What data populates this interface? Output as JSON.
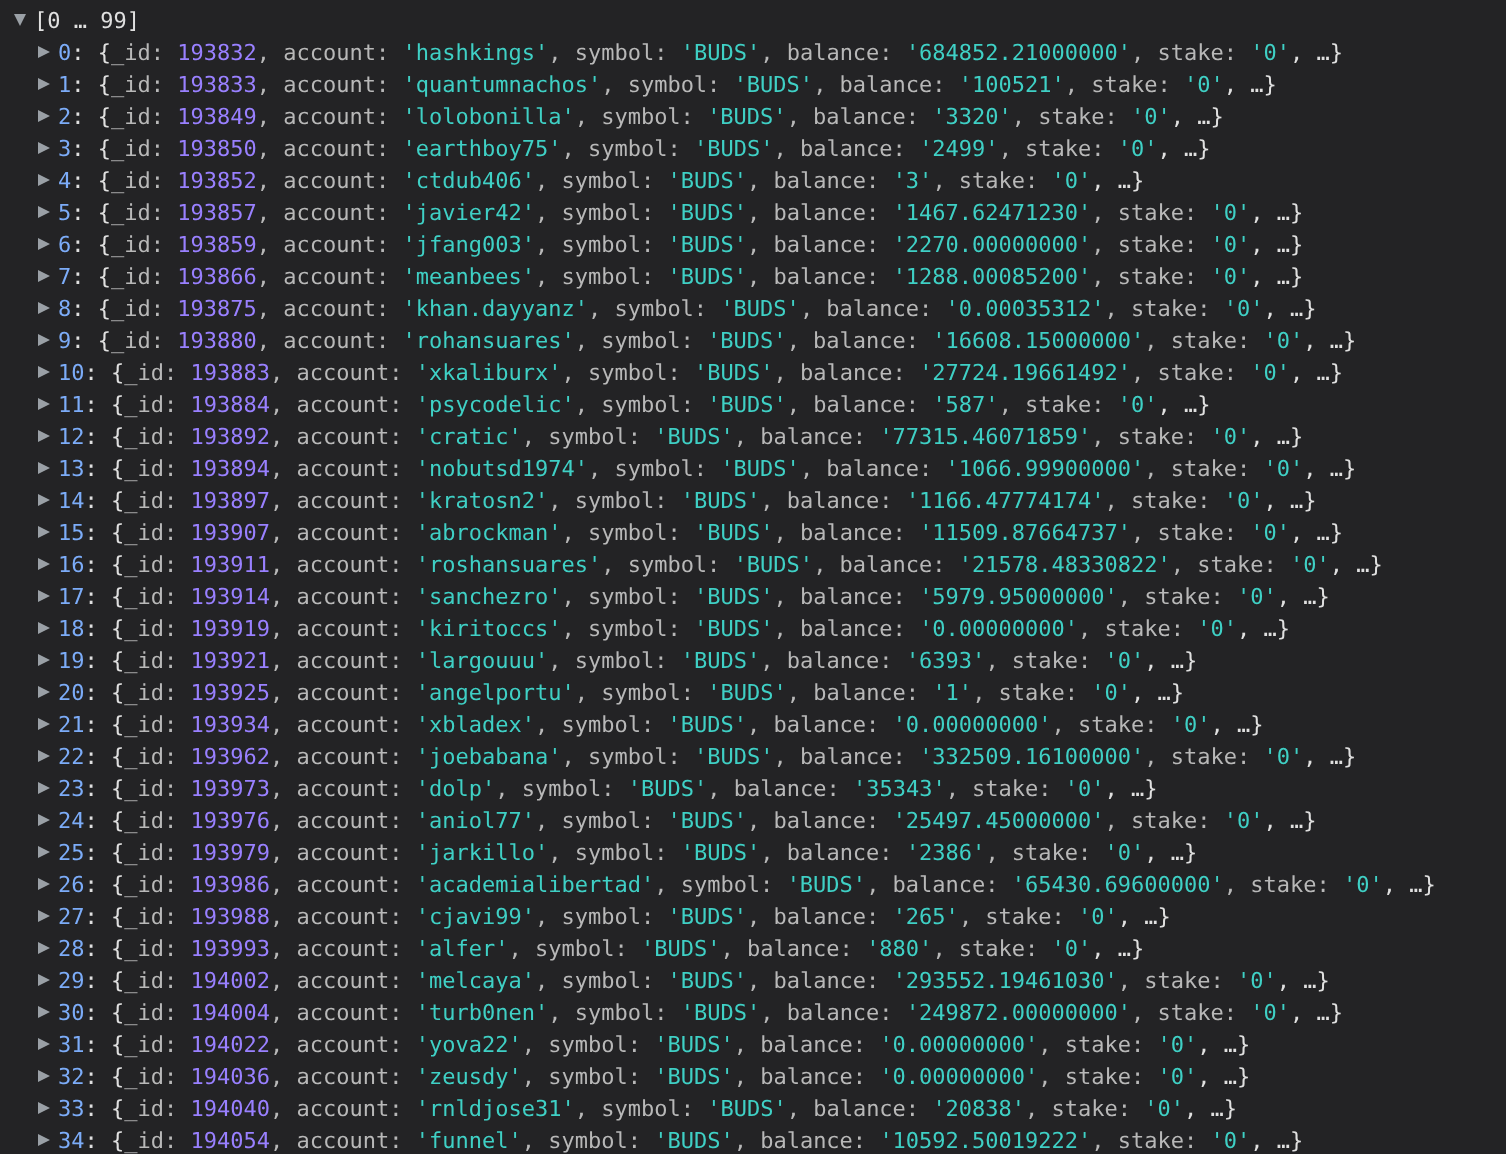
{
  "array": {
    "label": "[0 … 99]",
    "expanded": true
  },
  "rows": [
    {
      "expanded": false,
      "index": "0",
      "open": ": {",
      "fields": [
        {
          "key": "_id: ",
          "value": "193832",
          "kind": "number"
        },
        {
          "key": ", account: ",
          "value": "'hashkings'",
          "kind": "string"
        },
        {
          "key": ", symbol: ",
          "value": "'BUDS'",
          "kind": "string"
        },
        {
          "key": ", balance: ",
          "value": "'684852.21000000'",
          "kind": "string"
        },
        {
          "key": ", stake: ",
          "value": "'0'",
          "kind": "string"
        }
      ],
      "more": ", …}"
    },
    {
      "expanded": false,
      "index": "1",
      "open": ": {",
      "fields": [
        {
          "key": "_id: ",
          "value": "193833",
          "kind": "number"
        },
        {
          "key": ", account: ",
          "value": "'quantumnachos'",
          "kind": "string"
        },
        {
          "key": ", symbol: ",
          "value": "'BUDS'",
          "kind": "string"
        },
        {
          "key": ", balance: ",
          "value": "'100521'",
          "kind": "string"
        },
        {
          "key": ", stake: ",
          "value": "'0'",
          "kind": "string"
        }
      ],
      "more": ", …}"
    },
    {
      "expanded": false,
      "index": "2",
      "open": ": {",
      "fields": [
        {
          "key": "_id: ",
          "value": "193849",
          "kind": "number"
        },
        {
          "key": ", account: ",
          "value": "'lolobonilla'",
          "kind": "string"
        },
        {
          "key": ", symbol: ",
          "value": "'BUDS'",
          "kind": "string"
        },
        {
          "key": ", balance: ",
          "value": "'3320'",
          "kind": "string"
        },
        {
          "key": ", stake: ",
          "value": "'0'",
          "kind": "string"
        }
      ],
      "more": ", …}"
    },
    {
      "expanded": false,
      "index": "3",
      "open": ": {",
      "fields": [
        {
          "key": "_id: ",
          "value": "193850",
          "kind": "number"
        },
        {
          "key": ", account: ",
          "value": "'earthboy75'",
          "kind": "string"
        },
        {
          "key": ", symbol: ",
          "value": "'BUDS'",
          "kind": "string"
        },
        {
          "key": ", balance: ",
          "value": "'2499'",
          "kind": "string"
        },
        {
          "key": ", stake: ",
          "value": "'0'",
          "kind": "string"
        }
      ],
      "more": ", …}"
    },
    {
      "expanded": false,
      "index": "4",
      "open": ": {",
      "fields": [
        {
          "key": "_id: ",
          "value": "193852",
          "kind": "number"
        },
        {
          "key": ", account: ",
          "value": "'ctdub406'",
          "kind": "string"
        },
        {
          "key": ", symbol: ",
          "value": "'BUDS'",
          "kind": "string"
        },
        {
          "key": ", balance: ",
          "value": "'3'",
          "kind": "string"
        },
        {
          "key": ", stake: ",
          "value": "'0'",
          "kind": "string"
        }
      ],
      "more": ", …}"
    },
    {
      "expanded": false,
      "index": "5",
      "open": ": {",
      "fields": [
        {
          "key": "_id: ",
          "value": "193857",
          "kind": "number"
        },
        {
          "key": ", account: ",
          "value": "'javier42'",
          "kind": "string"
        },
        {
          "key": ", symbol: ",
          "value": "'BUDS'",
          "kind": "string"
        },
        {
          "key": ", balance: ",
          "value": "'1467.62471230'",
          "kind": "string"
        },
        {
          "key": ", stake: ",
          "value": "'0'",
          "kind": "string"
        }
      ],
      "more": ", …}"
    },
    {
      "expanded": false,
      "index": "6",
      "open": ": {",
      "fields": [
        {
          "key": "_id: ",
          "value": "193859",
          "kind": "number"
        },
        {
          "key": ", account: ",
          "value": "'jfang003'",
          "kind": "string"
        },
        {
          "key": ", symbol: ",
          "value": "'BUDS'",
          "kind": "string"
        },
        {
          "key": ", balance: ",
          "value": "'2270.00000000'",
          "kind": "string"
        },
        {
          "key": ", stake: ",
          "value": "'0'",
          "kind": "string"
        }
      ],
      "more": ", …}"
    },
    {
      "expanded": false,
      "index": "7",
      "open": ": {",
      "fields": [
        {
          "key": "_id: ",
          "value": "193866",
          "kind": "number"
        },
        {
          "key": ", account: ",
          "value": "'meanbees'",
          "kind": "string"
        },
        {
          "key": ", symbol: ",
          "value": "'BUDS'",
          "kind": "string"
        },
        {
          "key": ", balance: ",
          "value": "'1288.00085200'",
          "kind": "string"
        },
        {
          "key": ", stake: ",
          "value": "'0'",
          "kind": "string"
        }
      ],
      "more": ", …}"
    },
    {
      "expanded": false,
      "index": "8",
      "open": ": {",
      "fields": [
        {
          "key": "_id: ",
          "value": "193875",
          "kind": "number"
        },
        {
          "key": ", account: ",
          "value": "'khan.dayyanz'",
          "kind": "string"
        },
        {
          "key": ", symbol: ",
          "value": "'BUDS'",
          "kind": "string"
        },
        {
          "key": ", balance: ",
          "value": "'0.00035312'",
          "kind": "string"
        },
        {
          "key": ", stake: ",
          "value": "'0'",
          "kind": "string"
        }
      ],
      "more": ", …}"
    },
    {
      "expanded": false,
      "index": "9",
      "open": ": {",
      "fields": [
        {
          "key": "_id: ",
          "value": "193880",
          "kind": "number"
        },
        {
          "key": ", account: ",
          "value": "'rohansuares'",
          "kind": "string"
        },
        {
          "key": ", symbol: ",
          "value": "'BUDS'",
          "kind": "string"
        },
        {
          "key": ", balance: ",
          "value": "'16608.15000000'",
          "kind": "string"
        },
        {
          "key": ", stake: ",
          "value": "'0'",
          "kind": "string"
        }
      ],
      "more": ", …}"
    },
    {
      "expanded": false,
      "index": "10",
      "open": ": {",
      "fields": [
        {
          "key": "_id: ",
          "value": "193883",
          "kind": "number"
        },
        {
          "key": ", account: ",
          "value": "'xkaliburx'",
          "kind": "string"
        },
        {
          "key": ", symbol: ",
          "value": "'BUDS'",
          "kind": "string"
        },
        {
          "key": ", balance: ",
          "value": "'27724.19661492'",
          "kind": "string"
        },
        {
          "key": ", stake: ",
          "value": "'0'",
          "kind": "string"
        }
      ],
      "more": ", …}"
    },
    {
      "expanded": false,
      "index": "11",
      "open": ": {",
      "fields": [
        {
          "key": "_id: ",
          "value": "193884",
          "kind": "number"
        },
        {
          "key": ", account: ",
          "value": "'psycodelic'",
          "kind": "string"
        },
        {
          "key": ", symbol: ",
          "value": "'BUDS'",
          "kind": "string"
        },
        {
          "key": ", balance: ",
          "value": "'587'",
          "kind": "string"
        },
        {
          "key": ", stake: ",
          "value": "'0'",
          "kind": "string"
        }
      ],
      "more": ", …}"
    },
    {
      "expanded": false,
      "index": "12",
      "open": ": {",
      "fields": [
        {
          "key": "_id: ",
          "value": "193892",
          "kind": "number"
        },
        {
          "key": ", account: ",
          "value": "'cratic'",
          "kind": "string"
        },
        {
          "key": ", symbol: ",
          "value": "'BUDS'",
          "kind": "string"
        },
        {
          "key": ", balance: ",
          "value": "'77315.46071859'",
          "kind": "string"
        },
        {
          "key": ", stake: ",
          "value": "'0'",
          "kind": "string"
        }
      ],
      "more": ", …}"
    },
    {
      "expanded": false,
      "index": "13",
      "open": ": {",
      "fields": [
        {
          "key": "_id: ",
          "value": "193894",
          "kind": "number"
        },
        {
          "key": ", account: ",
          "value": "'nobutsd1974'",
          "kind": "string"
        },
        {
          "key": ", symbol: ",
          "value": "'BUDS'",
          "kind": "string"
        },
        {
          "key": ", balance: ",
          "value": "'1066.99900000'",
          "kind": "string"
        },
        {
          "key": ", stake: ",
          "value": "'0'",
          "kind": "string"
        }
      ],
      "more": ", …}"
    },
    {
      "expanded": false,
      "index": "14",
      "open": ": {",
      "fields": [
        {
          "key": "_id: ",
          "value": "193897",
          "kind": "number"
        },
        {
          "key": ", account: ",
          "value": "'kratosn2'",
          "kind": "string"
        },
        {
          "key": ", symbol: ",
          "value": "'BUDS'",
          "kind": "string"
        },
        {
          "key": ", balance: ",
          "value": "'1166.47774174'",
          "kind": "string"
        },
        {
          "key": ", stake: ",
          "value": "'0'",
          "kind": "string"
        }
      ],
      "more": ", …}"
    },
    {
      "expanded": false,
      "index": "15",
      "open": ": {",
      "fields": [
        {
          "key": "_id: ",
          "value": "193907",
          "kind": "number"
        },
        {
          "key": ", account: ",
          "value": "'abrockman'",
          "kind": "string"
        },
        {
          "key": ", symbol: ",
          "value": "'BUDS'",
          "kind": "string"
        },
        {
          "key": ", balance: ",
          "value": "'11509.87664737'",
          "kind": "string"
        },
        {
          "key": ", stake: ",
          "value": "'0'",
          "kind": "string"
        }
      ],
      "more": ", …}"
    },
    {
      "expanded": false,
      "index": "16",
      "open": ": {",
      "fields": [
        {
          "key": "_id: ",
          "value": "193911",
          "kind": "number"
        },
        {
          "key": ", account: ",
          "value": "'roshansuares'",
          "kind": "string"
        },
        {
          "key": ", symbol: ",
          "value": "'BUDS'",
          "kind": "string"
        },
        {
          "key": ", balance: ",
          "value": "'21578.48330822'",
          "kind": "string"
        },
        {
          "key": ", stake: ",
          "value": "'0'",
          "kind": "string"
        }
      ],
      "more": ", …}"
    },
    {
      "expanded": false,
      "index": "17",
      "open": ": {",
      "fields": [
        {
          "key": "_id: ",
          "value": "193914",
          "kind": "number"
        },
        {
          "key": ", account: ",
          "value": "'sanchezro'",
          "kind": "string"
        },
        {
          "key": ", symbol: ",
          "value": "'BUDS'",
          "kind": "string"
        },
        {
          "key": ", balance: ",
          "value": "'5979.95000000'",
          "kind": "string"
        },
        {
          "key": ", stake: ",
          "value": "'0'",
          "kind": "string"
        }
      ],
      "more": ", …}"
    },
    {
      "expanded": false,
      "index": "18",
      "open": ": {",
      "fields": [
        {
          "key": "_id: ",
          "value": "193919",
          "kind": "number"
        },
        {
          "key": ", account: ",
          "value": "'kiritoccs'",
          "kind": "string"
        },
        {
          "key": ", symbol: ",
          "value": "'BUDS'",
          "kind": "string"
        },
        {
          "key": ", balance: ",
          "value": "'0.00000000'",
          "kind": "string"
        },
        {
          "key": ", stake: ",
          "value": "'0'",
          "kind": "string"
        }
      ],
      "more": ", …}"
    },
    {
      "expanded": false,
      "index": "19",
      "open": ": {",
      "fields": [
        {
          "key": "_id: ",
          "value": "193921",
          "kind": "number"
        },
        {
          "key": ", account: ",
          "value": "'largouuu'",
          "kind": "string"
        },
        {
          "key": ", symbol: ",
          "value": "'BUDS'",
          "kind": "string"
        },
        {
          "key": ", balance: ",
          "value": "'6393'",
          "kind": "string"
        },
        {
          "key": ", stake: ",
          "value": "'0'",
          "kind": "string"
        }
      ],
      "more": ", …}"
    },
    {
      "expanded": false,
      "index": "20",
      "open": ": {",
      "fields": [
        {
          "key": "_id: ",
          "value": "193925",
          "kind": "number"
        },
        {
          "key": ", account: ",
          "value": "'angelportu'",
          "kind": "string"
        },
        {
          "key": ", symbol: ",
          "value": "'BUDS'",
          "kind": "string"
        },
        {
          "key": ", balance: ",
          "value": "'1'",
          "kind": "string"
        },
        {
          "key": ", stake: ",
          "value": "'0'",
          "kind": "string"
        }
      ],
      "more": ", …}"
    },
    {
      "expanded": false,
      "index": "21",
      "open": ": {",
      "fields": [
        {
          "key": "_id: ",
          "value": "193934",
          "kind": "number"
        },
        {
          "key": ", account: ",
          "value": "'xbladex'",
          "kind": "string"
        },
        {
          "key": ", symbol: ",
          "value": "'BUDS'",
          "kind": "string"
        },
        {
          "key": ", balance: ",
          "value": "'0.00000000'",
          "kind": "string"
        },
        {
          "key": ", stake: ",
          "value": "'0'",
          "kind": "string"
        }
      ],
      "more": ", …}"
    },
    {
      "expanded": false,
      "index": "22",
      "open": ": {",
      "fields": [
        {
          "key": "_id: ",
          "value": "193962",
          "kind": "number"
        },
        {
          "key": ", account: ",
          "value": "'joebabana'",
          "kind": "string"
        },
        {
          "key": ", symbol: ",
          "value": "'BUDS'",
          "kind": "string"
        },
        {
          "key": ", balance: ",
          "value": "'332509.16100000'",
          "kind": "string"
        },
        {
          "key": ", stake: ",
          "value": "'0'",
          "kind": "string"
        }
      ],
      "more": ", …}"
    },
    {
      "expanded": false,
      "index": "23",
      "open": ": {",
      "fields": [
        {
          "key": "_id: ",
          "value": "193973",
          "kind": "number"
        },
        {
          "key": ", account: ",
          "value": "'dolp'",
          "kind": "string"
        },
        {
          "key": ", symbol: ",
          "value": "'BUDS'",
          "kind": "string"
        },
        {
          "key": ", balance: ",
          "value": "'35343'",
          "kind": "string"
        },
        {
          "key": ", stake: ",
          "value": "'0'",
          "kind": "string"
        }
      ],
      "more": ", …}"
    },
    {
      "expanded": false,
      "index": "24",
      "open": ": {",
      "fields": [
        {
          "key": "_id: ",
          "value": "193976",
          "kind": "number"
        },
        {
          "key": ", account: ",
          "value": "'aniol77'",
          "kind": "string"
        },
        {
          "key": ", symbol: ",
          "value": "'BUDS'",
          "kind": "string"
        },
        {
          "key": ", balance: ",
          "value": "'25497.45000000'",
          "kind": "string"
        },
        {
          "key": ", stake: ",
          "value": "'0'",
          "kind": "string"
        }
      ],
      "more": ", …}"
    },
    {
      "expanded": false,
      "index": "25",
      "open": ": {",
      "fields": [
        {
          "key": "_id: ",
          "value": "193979",
          "kind": "number"
        },
        {
          "key": ", account: ",
          "value": "'jarkillo'",
          "kind": "string"
        },
        {
          "key": ", symbol: ",
          "value": "'BUDS'",
          "kind": "string"
        },
        {
          "key": ", balance: ",
          "value": "'2386'",
          "kind": "string"
        },
        {
          "key": ", stake: ",
          "value": "'0'",
          "kind": "string"
        }
      ],
      "more": ", …}"
    },
    {
      "expanded": false,
      "index": "26",
      "open": ": {",
      "fields": [
        {
          "key": "_id: ",
          "value": "193986",
          "kind": "number"
        },
        {
          "key": ", account: ",
          "value": "'academialibertad'",
          "kind": "string"
        },
        {
          "key": ", symbol: ",
          "value": "'BUDS'",
          "kind": "string"
        },
        {
          "key": ", balance: ",
          "value": "'65430.69600000'",
          "kind": "string"
        },
        {
          "key": ", stake: ",
          "value": "'0'",
          "kind": "string"
        }
      ],
      "more": ", …}"
    },
    {
      "expanded": false,
      "index": "27",
      "open": ": {",
      "fields": [
        {
          "key": "_id: ",
          "value": "193988",
          "kind": "number"
        },
        {
          "key": ", account: ",
          "value": "'cjavi99'",
          "kind": "string"
        },
        {
          "key": ", symbol: ",
          "value": "'BUDS'",
          "kind": "string"
        },
        {
          "key": ", balance: ",
          "value": "'265'",
          "kind": "string"
        },
        {
          "key": ", stake: ",
          "value": "'0'",
          "kind": "string"
        }
      ],
      "more": ", …}"
    },
    {
      "expanded": false,
      "index": "28",
      "open": ": {",
      "fields": [
        {
          "key": "_id: ",
          "value": "193993",
          "kind": "number"
        },
        {
          "key": ", account: ",
          "value": "'alfer'",
          "kind": "string"
        },
        {
          "key": ", symbol: ",
          "value": "'BUDS'",
          "kind": "string"
        },
        {
          "key": ", balance: ",
          "value": "'880'",
          "kind": "string"
        },
        {
          "key": ", stake: ",
          "value": "'0'",
          "kind": "string"
        }
      ],
      "more": ", …}"
    },
    {
      "expanded": false,
      "index": "29",
      "open": ": {",
      "fields": [
        {
          "key": "_id: ",
          "value": "194002",
          "kind": "number"
        },
        {
          "key": ", account: ",
          "value": "'melcaya'",
          "kind": "string"
        },
        {
          "key": ", symbol: ",
          "value": "'BUDS'",
          "kind": "string"
        },
        {
          "key": ", balance: ",
          "value": "'293552.19461030'",
          "kind": "string"
        },
        {
          "key": ", stake: ",
          "value": "'0'",
          "kind": "string"
        }
      ],
      "more": ", …}"
    },
    {
      "expanded": false,
      "index": "30",
      "open": ": {",
      "fields": [
        {
          "key": "_id: ",
          "value": "194004",
          "kind": "number"
        },
        {
          "key": ", account: ",
          "value": "'turb0nen'",
          "kind": "string"
        },
        {
          "key": ", symbol: ",
          "value": "'BUDS'",
          "kind": "string"
        },
        {
          "key": ", balance: ",
          "value": "'249872.00000000'",
          "kind": "string"
        },
        {
          "key": ", stake: ",
          "value": "'0'",
          "kind": "string"
        }
      ],
      "more": ", …}"
    },
    {
      "expanded": false,
      "index": "31",
      "open": ": {",
      "fields": [
        {
          "key": "_id: ",
          "value": "194022",
          "kind": "number"
        },
        {
          "key": ", account: ",
          "value": "'yova22'",
          "kind": "string"
        },
        {
          "key": ", symbol: ",
          "value": "'BUDS'",
          "kind": "string"
        },
        {
          "key": ", balance: ",
          "value": "'0.00000000'",
          "kind": "string"
        },
        {
          "key": ", stake: ",
          "value": "'0'",
          "kind": "string"
        }
      ],
      "more": ", …}"
    },
    {
      "expanded": false,
      "index": "32",
      "open": ": {",
      "fields": [
        {
          "key": "_id: ",
          "value": "194036",
          "kind": "number"
        },
        {
          "key": ", account: ",
          "value": "'zeusdy'",
          "kind": "string"
        },
        {
          "key": ", symbol: ",
          "value": "'BUDS'",
          "kind": "string"
        },
        {
          "key": ", balance: ",
          "value": "'0.00000000'",
          "kind": "string"
        },
        {
          "key": ", stake: ",
          "value": "'0'",
          "kind": "string"
        }
      ],
      "more": ", …}"
    },
    {
      "expanded": false,
      "index": "33",
      "open": ": {",
      "fields": [
        {
          "key": "_id: ",
          "value": "194040",
          "kind": "number"
        },
        {
          "key": ", account: ",
          "value": "'rnldjose31'",
          "kind": "string"
        },
        {
          "key": ", symbol: ",
          "value": "'BUDS'",
          "kind": "string"
        },
        {
          "key": ", balance: ",
          "value": "'20838'",
          "kind": "string"
        },
        {
          "key": ", stake: ",
          "value": "'0'",
          "kind": "string"
        }
      ],
      "more": ", …}"
    },
    {
      "expanded": false,
      "index": "34",
      "open": ": {",
      "fields": [
        {
          "key": "_id: ",
          "value": "194054",
          "kind": "number"
        },
        {
          "key": ", account: ",
          "value": "'funnel'",
          "kind": "string"
        },
        {
          "key": ", symbol: ",
          "value": "'BUDS'",
          "kind": "string"
        },
        {
          "key": ", balance: ",
          "value": "'10592.50019222'",
          "kind": "string"
        },
        {
          "key": ", stake: ",
          "value": "'0'",
          "kind": "string"
        }
      ],
      "more": ", …}"
    }
  ]
}
